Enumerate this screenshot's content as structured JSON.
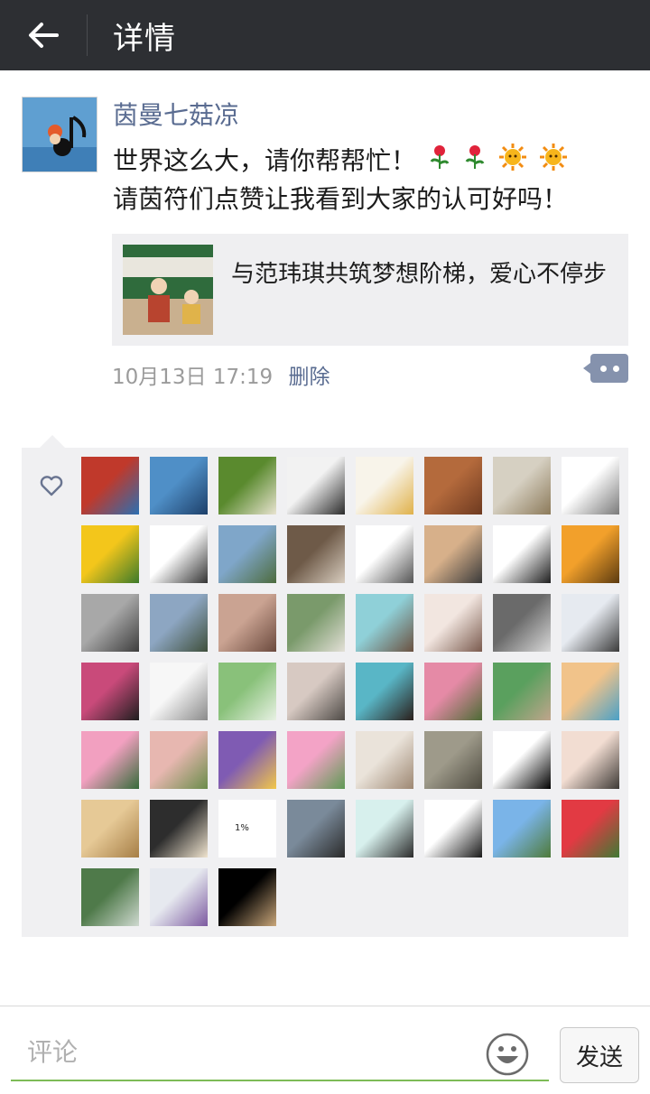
{
  "header": {
    "title": "详情"
  },
  "post": {
    "username": "茵曼七菇凉",
    "text_line1": "世界这么大，请你帮帮忙！",
    "text_line2": "请茵符们点赞让我看到大家的认可好吗！",
    "share": {
      "title": "与范玮琪共筑梦想阶梯，爱心不停步"
    },
    "time": "10月13日 17:19",
    "delete_label": "删除"
  },
  "likes": {
    "tiles": [
      {
        "c1": "#c0392b",
        "c2": "#2b6fb2"
      },
      {
        "c1": "#4f8fc7",
        "c2": "#1d3f69"
      },
      {
        "c1": "#5a8a2e",
        "c2": "#e8e3d0"
      },
      {
        "c1": "#f2f2f2",
        "c2": "#2b2b2b"
      },
      {
        "c1": "#f8f4ea",
        "c2": "#e0b14a"
      },
      {
        "c1": "#b46a3c",
        "c2": "#6e3a20"
      },
      {
        "c1": "#d6d0c2",
        "c2": "#8c7a5a"
      },
      {
        "c1": "#ffffff",
        "c2": "#7a7a7a"
      },
      {
        "c1": "#f3c61b",
        "c2": "#3c7a2a"
      },
      {
        "c1": "#ffffff",
        "c2": "#333333"
      },
      {
        "c1": "#7fa6c9",
        "c2": "#4d6b3d"
      },
      {
        "c1": "#6e5a48",
        "c2": "#d8cdbf"
      },
      {
        "c1": "#ffffff",
        "c2": "#555555"
      },
      {
        "c1": "#d7b08a",
        "c2": "#3a3a3a"
      },
      {
        "c1": "#ffffff",
        "c2": "#1f1f1f"
      },
      {
        "c1": "#f2a02b",
        "c2": "#5b3a10"
      },
      {
        "c1": "#a8a8a8",
        "c2": "#3d3d3d"
      },
      {
        "c1": "#8da6c2",
        "c2": "#3f4f3b"
      },
      {
        "c1": "#caa392",
        "c2": "#6b4a3e"
      },
      {
        "c1": "#7a9a6b",
        "c2": "#e3e0d7"
      },
      {
        "c1": "#8fd0d8",
        "c2": "#6b5140"
      },
      {
        "c1": "#f2e6e0",
        "c2": "#7a5a4e"
      },
      {
        "c1": "#6a6a6a",
        "c2": "#d9d9d9"
      },
      {
        "c1": "#e6eaf0",
        "c2": "#3b3b3b"
      },
      {
        "c1": "#c94a7a",
        "c2": "#1e1e1e"
      },
      {
        "c1": "#f7f7f7",
        "c2": "#8a8a8a"
      },
      {
        "c1": "#89c17a",
        "c2": "#e8f1e4"
      },
      {
        "c1": "#d7c9c2",
        "c2": "#4e4a46"
      },
      {
        "c1": "#59b6c6",
        "c2": "#2a1f1b"
      },
      {
        "c1": "#e58aa6",
        "c2": "#4d6b35"
      },
      {
        "c1": "#5aa05e",
        "c2": "#c0a58c"
      },
      {
        "c1": "#f1c38a",
        "c2": "#4aa0c7"
      },
      {
        "c1": "#f2a0c0",
        "c2": "#356b3a"
      },
      {
        "c1": "#e7b7b0",
        "c2": "#6a8c4a"
      },
      {
        "c1": "#7f5bb3",
        "c2": "#f2c74a"
      },
      {
        "c1": "#f3a3c6",
        "c2": "#5f9a55"
      },
      {
        "c1": "#eae3da",
        "c2": "#9d8772"
      },
      {
        "c1": "#9e9a8a",
        "c2": "#4d4a3f"
      },
      {
        "c1": "#ffffff",
        "c2": "#000000"
      },
      {
        "c1": "#f2ddd2",
        "c2": "#3e3a36"
      },
      {
        "c1": "#e6c996",
        "c2": "#a67e46"
      },
      {
        "c1": "#2d2d2d",
        "c2": "#f0e4cf"
      },
      {
        "c1": "#ffffff",
        "c2": "#ffffff"
      },
      {
        "c1": "#7a8a9a",
        "c2": "#2a2a2a"
      },
      {
        "c1": "#d7f0ed",
        "c2": "#2b2b2b"
      },
      {
        "c1": "#ffffff",
        "c2": "#1a1a1a"
      },
      {
        "c1": "#7ab4e8",
        "c2": "#4f7a3a"
      },
      {
        "c1": "#e23a43",
        "c2": "#3f7a35"
      },
      {
        "c1": "#4f7a4a",
        "c2": "#cfd9d0"
      },
      {
        "c1": "#e6e9ef",
        "c2": "#7c5aa0"
      },
      {
        "c1": "#000000",
        "c2": "#c9a67a"
      }
    ],
    "tile_text": "1%"
  },
  "input": {
    "placeholder": "评论"
  },
  "send_label": "发送",
  "colors": {
    "header_bg": "#2d2f33",
    "link": "#5a6c91",
    "input_underline": "#7dbb56"
  }
}
